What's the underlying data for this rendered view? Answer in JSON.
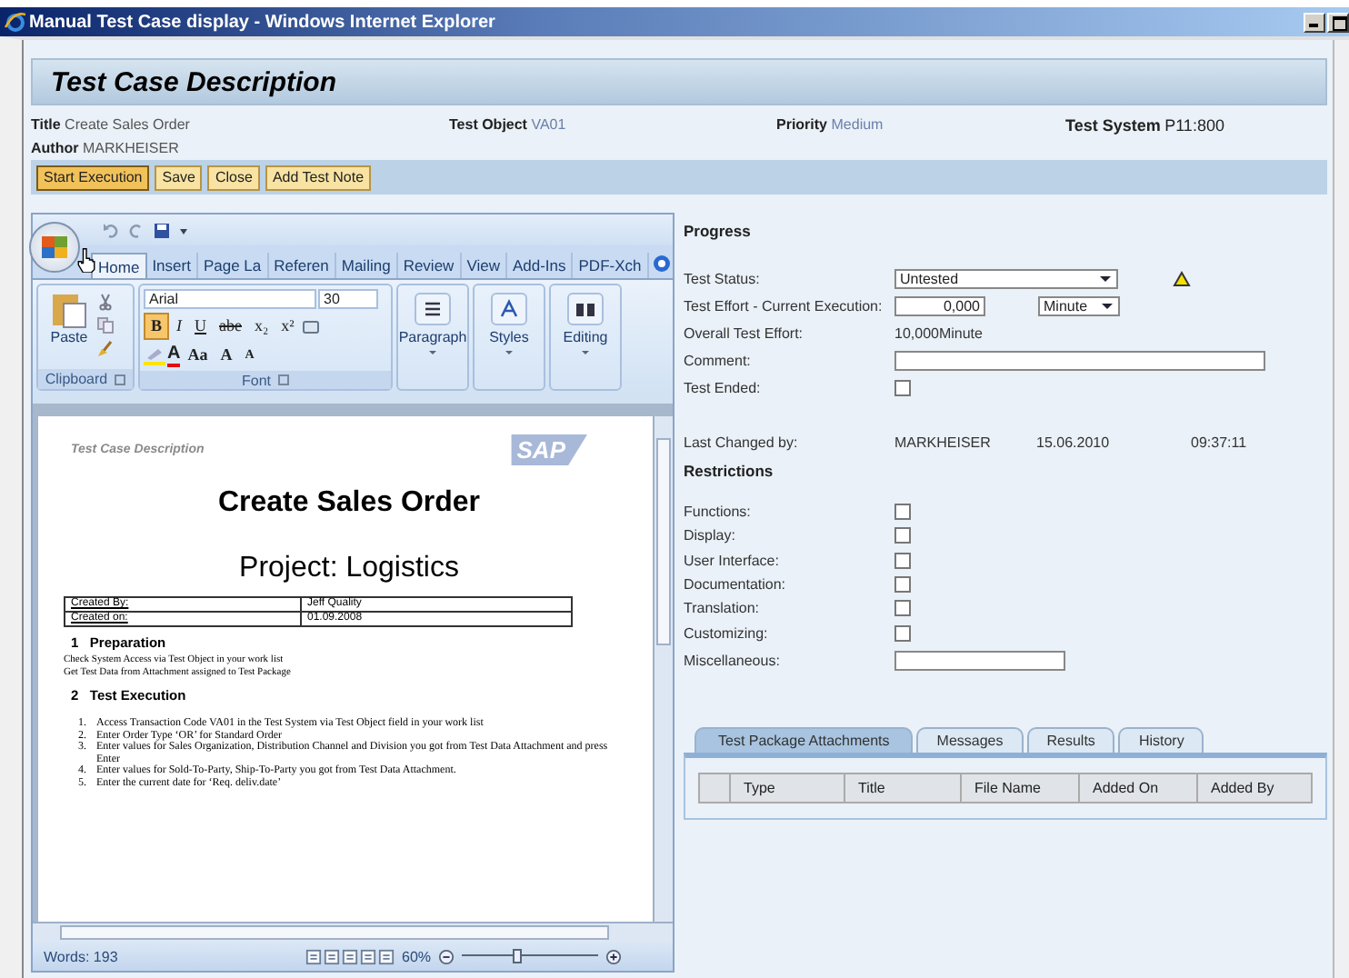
{
  "window": {
    "title": "Manual Test Case display - Windows Internet Explorer"
  },
  "header": {
    "title": "Test Case Description"
  },
  "info": [
    {
      "label": "Title",
      "value": "Create Sales Order"
    },
    {
      "label": "Test Object",
      "value": "VA01"
    },
    {
      "label": "Priority",
      "value": "Medium"
    },
    {
      "label": "Test System",
      "value": "P11:800"
    },
    {
      "label": "Author",
      "value": "MARKHEISER"
    }
  ],
  "buttons": [
    {
      "label": "Start Execution",
      "selected": true
    },
    {
      "label": "Save",
      "selected": false
    },
    {
      "label": "Close",
      "selected": false
    },
    {
      "label": "Add Test Note",
      "selected": false
    }
  ],
  "word": {
    "tabs": [
      {
        "label": "Home",
        "selected": true
      },
      {
        "label": "Insert",
        "selected": false
      },
      {
        "label": "Page La",
        "selected": false
      },
      {
        "label": "Referen",
        "selected": false
      },
      {
        "label": "Mailing",
        "selected": false
      },
      {
        "label": "Review",
        "selected": false
      },
      {
        "label": "View",
        "selected": false
      },
      {
        "label": "Add-Ins",
        "selected": false
      },
      {
        "label": "PDF-Xch",
        "selected": false
      }
    ],
    "clipboard": {
      "paste": "Paste",
      "label": "Clipboard"
    },
    "font": {
      "label": "Font",
      "name": "Arial",
      "size": "30",
      "format_buttons": [
        {
          "label": "B",
          "selected": true
        },
        {
          "label": "I",
          "selected": false
        },
        {
          "label": "U",
          "selected": false
        },
        {
          "label": "abe",
          "selected": false
        },
        {
          "label": "x₂",
          "selected": false
        },
        {
          "label": "x²",
          "selected": false
        }
      ],
      "color_letter": "A",
      "case": "Aa",
      "grow": "A",
      "shrink": "A"
    },
    "big_groups": [
      "Paragraph",
      "Styles",
      "Editing"
    ],
    "document": {
      "header": "Test Case Description",
      "logo": "SAP",
      "title": "Create Sales Order",
      "subtitle": "Project: Logistics",
      "table": [
        {
          "label": "Created By:",
          "value": "Jeff Quality"
        },
        {
          "label": "Created on:",
          "value": "01.09.2008"
        }
      ],
      "sections": [
        {
          "number": "1",
          "heading": "Preparation",
          "paragraphs": [
            "Check System Access via Test Object in your work list",
            "Get Test Data from Attachment assigned to Test Package"
          ]
        },
        {
          "number": "2",
          "heading": "Test Execution",
          "steps": [
            {
              "number": "1.",
              "text": "Access Transaction Code VA01 in the Test System via Test Object field in your work list"
            },
            {
              "number": "2.",
              "text": "Enter Order Type ‘OR’ for Standard Order"
            },
            {
              "number": "3.",
              "text": "Enter values for Sales Organization, Distribution Channel and Division you got from Test Data Attachment and press Enter"
            },
            {
              "number": "4.",
              "text": "Enter values for Sold-To-Party, Ship-To-Party you got from Test Data Attachment."
            },
            {
              "number": "5.",
              "text": "Enter the current date for ‘Req. deliv.date’"
            }
          ]
        }
      ]
    },
    "status": {
      "words": "Words: 193",
      "zoom": "60%",
      "zoom_slider": {
        "level": 0.4
      }
    }
  },
  "progress": {
    "title": "Progress",
    "rows": [
      {
        "kind": "select",
        "label": "Test Status:",
        "value": "Untested",
        "warning": true
      },
      {
        "kind": "number",
        "label": "Test Effort - Current Execution:",
        "value": "0,000",
        "unit": "Minute"
      },
      {
        "kind": "text",
        "label": "Overall Test Effort:",
        "value": "10,000",
        "unit": "Minute"
      },
      {
        "kind": "input",
        "label": "Comment:"
      },
      {
        "kind": "checkbox",
        "label": "Test Ended:",
        "checked": false
      }
    ],
    "last_changed": {
      "label": "Last Changed by:",
      "values": [
        "MARKHEISER",
        "15.06.2010",
        "09:37:11"
      ]
    }
  },
  "restrictions": {
    "title": "Restrictions",
    "rows": [
      {
        "kind": "checkbox",
        "label": "Functions:",
        "checked": false
      },
      {
        "kind": "checkbox",
        "label": "Display:",
        "checked": false
      },
      {
        "kind": "checkbox",
        "label": "User Interface:",
        "checked": false
      },
      {
        "kind": "checkbox",
        "label": "Documentation:",
        "checked": false
      },
      {
        "kind": "checkbox",
        "label": "Translation:",
        "checked": false
      },
      {
        "kind": "checkbox",
        "label": "Customizing:",
        "checked": false
      },
      {
        "kind": "input",
        "label": "Miscellaneous:"
      }
    ]
  },
  "detail_tabs": [
    {
      "label": "Test Package Attachments",
      "selected": true
    },
    {
      "label": "Messages",
      "selected": false
    },
    {
      "label": "Results",
      "selected": false
    },
    {
      "label": "History",
      "selected": false
    }
  ],
  "attachments": {
    "columns": [
      "Type",
      "Title",
      "File Name",
      "Added On",
      "Added By"
    ]
  }
}
